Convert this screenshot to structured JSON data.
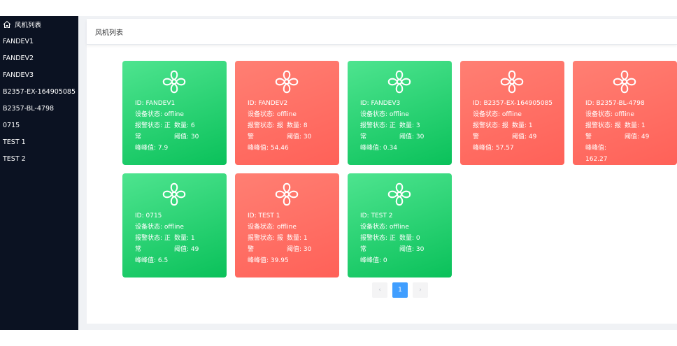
{
  "sidebar": {
    "home_label": "风机列表",
    "items": [
      "FANDEV1",
      "FANDEV2",
      "FANDEV3",
      "B2357-EX-164905085",
      "B2357-BL-4798",
      "0715",
      "TEST 1",
      "TEST 2"
    ]
  },
  "header": {
    "title": "风机列表"
  },
  "labels": {
    "id": "ID:",
    "device_status": "设备状态:",
    "alarm_status": "报警状态:",
    "count": "数量:",
    "threshold": "阈值:",
    "peak": "峰峰值:"
  },
  "cards": [
    {
      "id": "FANDEV1",
      "device_status": "offline",
      "alarm_a": "正",
      "alarm_b": "常",
      "count": "6",
      "threshold": "30",
      "peak": "7.9",
      "state": "ok"
    },
    {
      "id": "FANDEV2",
      "device_status": "offline",
      "alarm_a": "报",
      "alarm_b": "警",
      "count": "8",
      "threshold": "30",
      "peak": "54.46",
      "state": "alarm"
    },
    {
      "id": "FANDEV3",
      "device_status": "offline",
      "alarm_a": "正",
      "alarm_b": "常",
      "count": "3",
      "threshold": "30",
      "peak": "0.34",
      "state": "ok"
    },
    {
      "id": "B2357-EX-164905085",
      "device_status": "offline",
      "alarm_a": "报",
      "alarm_b": "警",
      "count": "1",
      "threshold": "49",
      "peak": "57.57",
      "state": "alarm"
    },
    {
      "id": "B2357-BL-4798",
      "device_status": "offline",
      "alarm_a": "报",
      "alarm_b": "警",
      "count": "1",
      "threshold": "49",
      "peak": "162.27",
      "state": "alarm"
    },
    {
      "id": "0715",
      "device_status": "offline",
      "alarm_a": "正",
      "alarm_b": "常",
      "count": "1",
      "threshold": "49",
      "peak": "6.5",
      "state": "ok"
    },
    {
      "id": "TEST 1",
      "device_status": "offline",
      "alarm_a": "报",
      "alarm_b": "警",
      "count": "1",
      "threshold": "30",
      "peak": "39.95",
      "state": "alarm"
    },
    {
      "id": "TEST 2",
      "device_status": "offline",
      "alarm_a": "正",
      "alarm_b": "常",
      "count": "0",
      "threshold": "30",
      "peak": "0",
      "state": "ok"
    }
  ],
  "pagination": {
    "prev": "‹",
    "current": "1",
    "next": "›"
  },
  "colors": {
    "ok": "#19cf6c",
    "alarm": "#ff6c63",
    "sidebar": "#0b1222",
    "accent": "#409eff"
  }
}
